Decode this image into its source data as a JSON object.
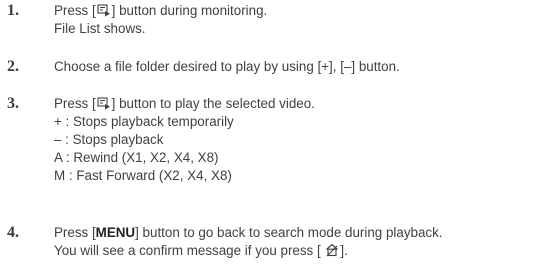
{
  "steps": [
    {
      "number": "1.",
      "line1": {
        "pre": "Press [",
        "post": "] button during monitoring."
      },
      "line2": "File List shows."
    },
    {
      "number": "2.",
      "text": "Choose a file folder desired to play by using [+], [–] button."
    },
    {
      "number": "3.",
      "line1": {
        "pre": "Press [",
        "post": "] button to play the selected video."
      },
      "sub": [
        "+ : Stops playback temporarily",
        "– : Stops playback",
        "A : Rewind (X1, X2, X4, X8)",
        "M : Fast Forward (X2, X4, X8)"
      ]
    },
    {
      "number": "4.",
      "line1": {
        "pre": "Press [",
        "key": "MENU",
        "post": "] button to go back to search mode during playback."
      },
      "line2": {
        "pre": "You will see a confirm message if you press [ ",
        "post": "]."
      }
    }
  ],
  "icons": {
    "search_play": "search-play-icon",
    "exit": "exit-icon"
  }
}
